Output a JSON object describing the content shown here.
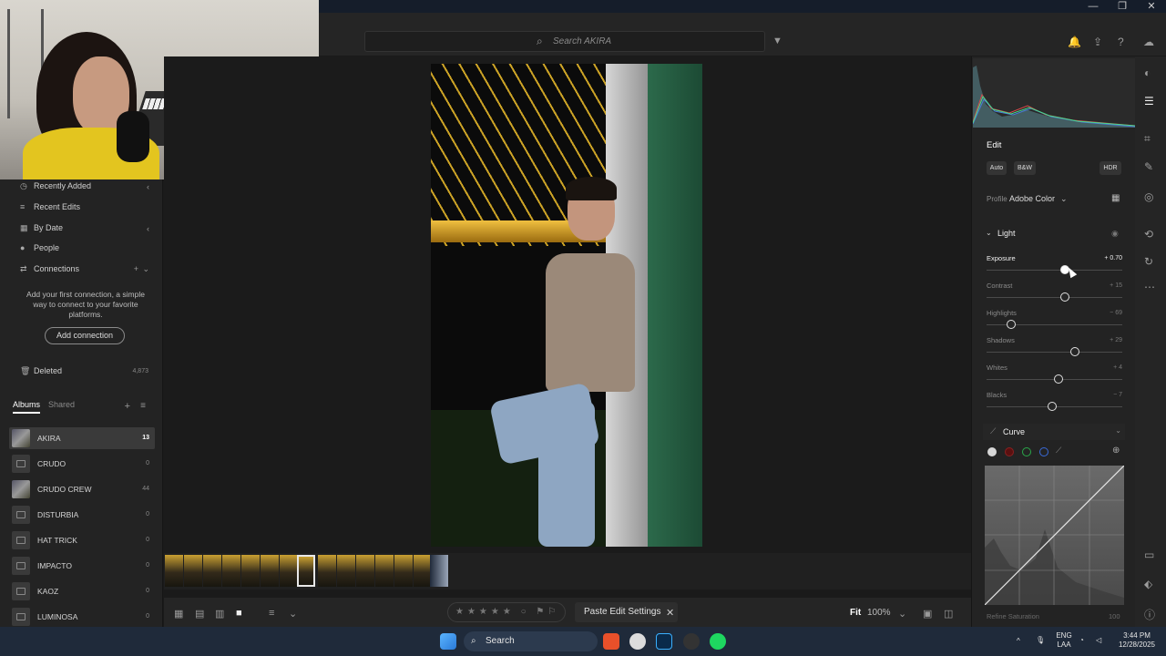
{
  "window": {
    "minimize": "—",
    "restore": "❐",
    "close": "✕"
  },
  "toolbar": {
    "search_placeholder": "Search AKIRA"
  },
  "left_nav": [
    {
      "label": "Recently Added",
      "icon": "clock-icon"
    },
    {
      "label": "Recent Edits",
      "icon": "edit-list-icon"
    },
    {
      "label": "By Date",
      "icon": "calendar-icon"
    },
    {
      "label": "People",
      "icon": "person-icon"
    },
    {
      "label": "Connections",
      "icon": "connections-icon"
    }
  ],
  "connections": {
    "message": "Add your first connection, a simple way to connect to your favorite platforms.",
    "button": "Add connection"
  },
  "deleted": {
    "label": "Deleted",
    "count": "4,873"
  },
  "album_tabs": {
    "albums": "Albums",
    "shared": "Shared"
  },
  "albums": [
    {
      "name": "AKIRA",
      "count": "13"
    },
    {
      "name": "CRUDO",
      "count": "0"
    },
    {
      "name": "CRUDO CREW",
      "count": "44"
    },
    {
      "name": "DISTURBIA",
      "count": "0"
    },
    {
      "name": "HAT TRICK",
      "count": "0"
    },
    {
      "name": "IMPACTO",
      "count": "0"
    },
    {
      "name": "KAOZ",
      "count": "0"
    },
    {
      "name": "LUMINOSA",
      "count": "0"
    }
  ],
  "bottom": {
    "paste": "Paste Edit Settings",
    "fit": "Fit",
    "zoom": "100%"
  },
  "edit": {
    "title": "Edit",
    "auto": "Auto",
    "bw": "B&W",
    "hdr": "HDR",
    "profile_label": "Profile",
    "profile_value": "Adobe Color",
    "light": "Light",
    "curve": "Curve",
    "refine": "Refine Saturation",
    "refine_value": "100",
    "sliders": [
      {
        "label": "Exposure",
        "value": "+ 0.70",
        "pos": 0.58
      },
      {
        "label": "Contrast",
        "value": "+ 15",
        "pos": 0.58
      },
      {
        "label": "Highlights",
        "value": "− 69",
        "pos": 0.18
      },
      {
        "label": "Shadows",
        "value": "+ 29",
        "pos": 0.65
      },
      {
        "label": "Whites",
        "value": "+ 4",
        "pos": 0.53
      },
      {
        "label": "Blacks",
        "value": "− 7",
        "pos": 0.48
      }
    ]
  },
  "taskbar": {
    "search": "Search",
    "lang1": "ENG",
    "lang2": "LAA",
    "time": "3:44 PM",
    "date": "12/28/2025"
  }
}
